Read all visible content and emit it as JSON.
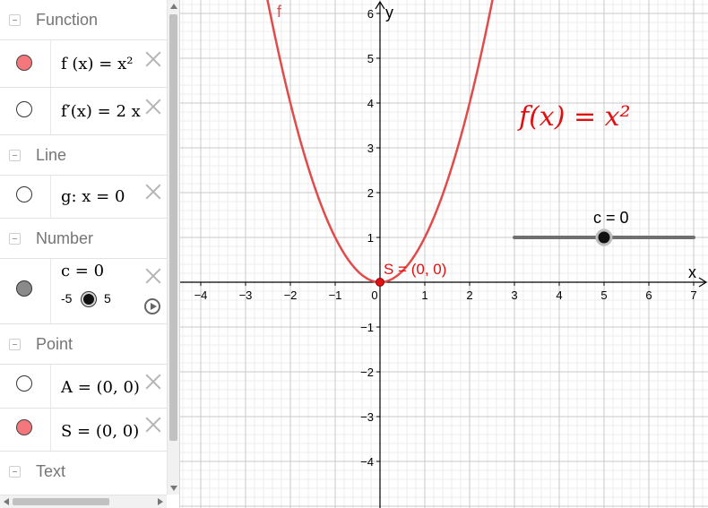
{
  "algebra": {
    "groups": {
      "function": "Function",
      "line": "Line",
      "number": "Number",
      "point": "Point",
      "text": "Text"
    },
    "rows": {
      "f": "f (x) = x²",
      "fprime": "f′(x) = 2 x",
      "g": "g: x = 0",
      "c": "c = 0",
      "c_min": "-5",
      "c_max": "5",
      "A": "A = (0, 0)",
      "S": "S = (0, 0)"
    }
  },
  "graphics": {
    "curve_label": "f",
    "x_axis_label": "x",
    "y_axis_label": "y",
    "point_label": "S = (0, 0)",
    "formula_text": "f(x) = x²",
    "slider_label": "c = 0",
    "slider_value": 0,
    "slider_min": -5,
    "slider_max": 5
  },
  "colors": {
    "function": "#e04b4b",
    "point": "#e01010",
    "axis": "#000000",
    "grid_major": "#c8c8c8",
    "grid_minor": "#ececec",
    "slider_track": "#707070",
    "marble_red": "#f4777b",
    "marble_grey": "#8a8a8a"
  },
  "chart_data": {
    "type": "line",
    "xlim": [
      -4.3,
      7.3
    ],
    "ylim": [
      -5,
      6.3
    ],
    "x_ticks": [
      "−4",
      "−3",
      "−2",
      "−1",
      "0",
      "1",
      "2",
      "3",
      "4",
      "5",
      "6",
      "7"
    ],
    "y_ticks": [
      "−4",
      "−3",
      "−2",
      "−1",
      "1",
      "2",
      "3",
      "4",
      "5",
      "6"
    ],
    "grid": true,
    "series": [
      {
        "name": "f",
        "expression": "x^2",
        "x": [
          -2.5,
          -2,
          -1.5,
          -1,
          -0.5,
          0,
          0.5,
          1,
          1.5,
          2,
          2.5
        ],
        "y": [
          6.25,
          4,
          2.25,
          1,
          0.25,
          0,
          0.25,
          1,
          2.25,
          4,
          6.25
        ]
      }
    ],
    "points": [
      {
        "name": "S",
        "x": 0,
        "y": 0
      }
    ]
  }
}
